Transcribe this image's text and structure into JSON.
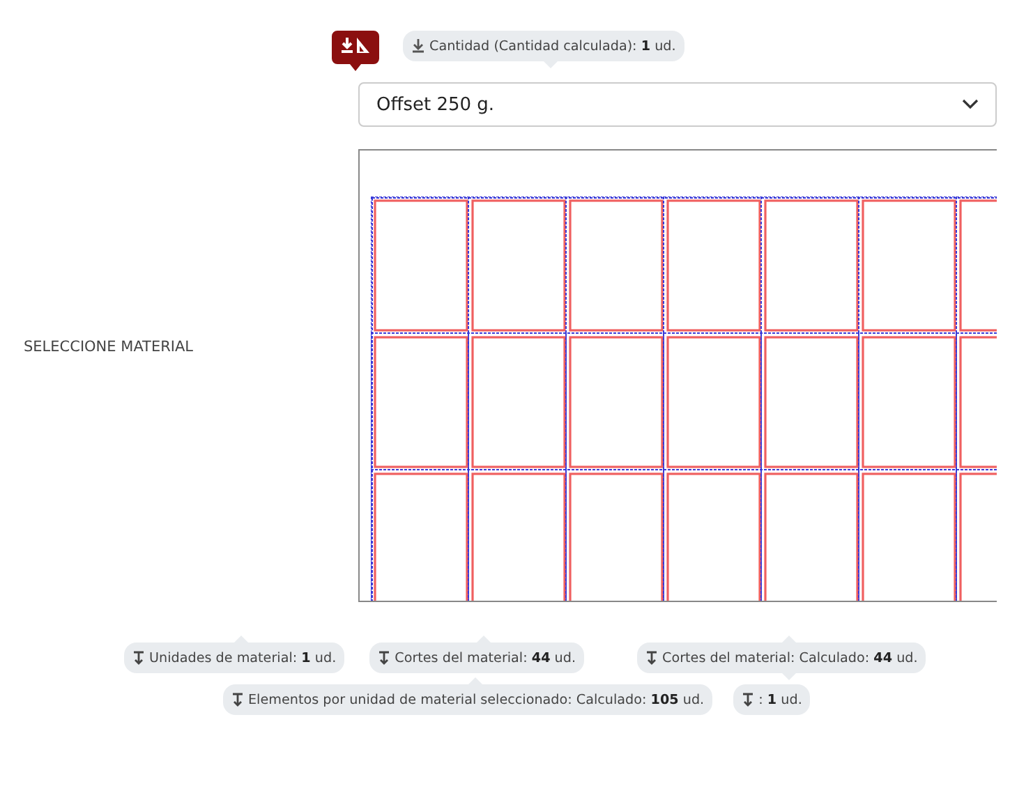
{
  "header": {
    "badge": {
      "kind": "material-quantity"
    },
    "tip": {
      "text": "Cantidad (Cantidad calculada): **1** ud.",
      "pointer_up": false,
      "pointer_down": true
    }
  },
  "field": {
    "label": "SELECCIONE MATERIAL",
    "select": {
      "value": "Offset 250 g."
    }
  },
  "tips": [
    [
      {
        "text": "Unidades de material: **1** ud.",
        "pointer_up": true,
        "pointer_down": false
      },
      {
        "text": "Cortes del material: **44** ud.",
        "pointer_up": true,
        "pointer_down": false
      },
      {
        "text": "Cortes del material: Calculado: **44** ud.",
        "pointer_up": true,
        "pointer_down": true
      }
    ],
    [
      {
        "text": "Elementos por unidad de material seleccionado: Calculado: **105** ud.",
        "pointer_up": true,
        "pointer_down": false
      },
      {
        "text": ": **1** ud.",
        "pointer_up": false,
        "pointer_down": false
      }
    ]
  ]
}
